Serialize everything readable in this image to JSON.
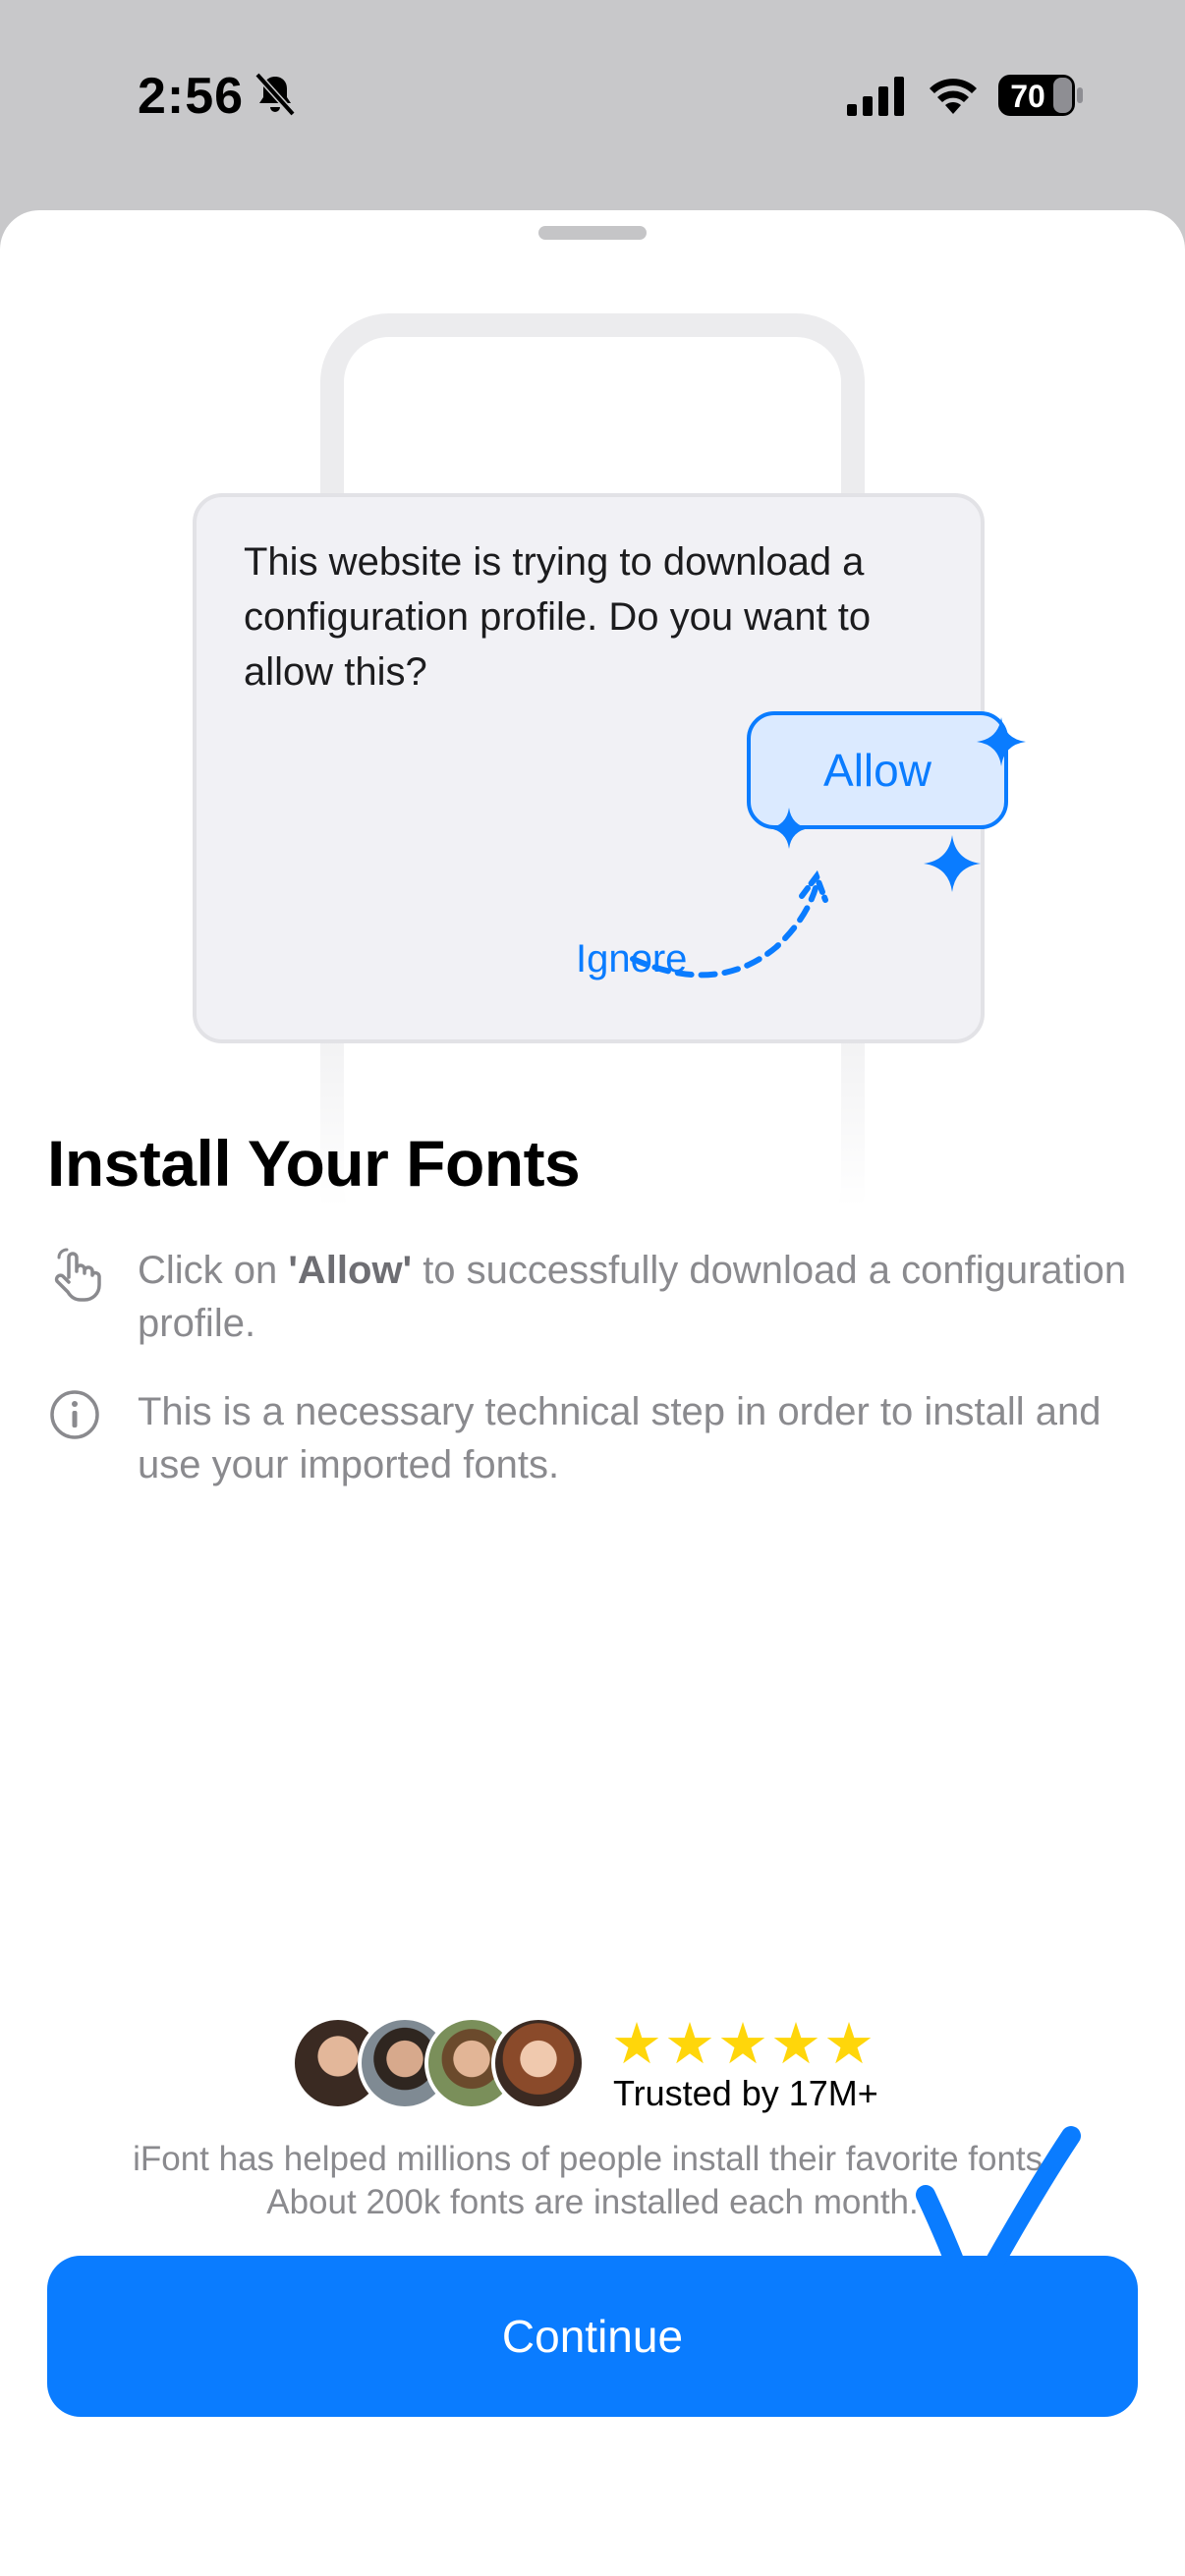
{
  "status_bar": {
    "time": "2:56",
    "battery": "70",
    "icons": [
      "bell-slash-icon",
      "signal-icon",
      "wifi-icon",
      "battery-icon"
    ]
  },
  "illustration": {
    "dialog_text": "This website is trying to download a configuration profile. Do you want to allow this?",
    "ignore_label": "Ignore",
    "allow_label": "Allow"
  },
  "content": {
    "title": "Install Your Fonts",
    "info_items": [
      {
        "icon": "hand-tap-icon",
        "text_before": "Click on ",
        "text_bold": "'Allow'",
        "text_after": " to successfully download a configuration profile."
      },
      {
        "icon": "info-circle-icon",
        "text": "This is a necessary technical step in order to install and use your imported fonts."
      }
    ]
  },
  "trust": {
    "stars": "★★★★★",
    "rating": 5,
    "trusted_label": "Trusted by 17M+",
    "line1": "iFont has helped millions of people install their favorite fonts.",
    "line2": "About 200k fonts are installed each month."
  },
  "cta": {
    "continue_label": "Continue"
  },
  "colors": {
    "accent": "#0a7cff",
    "star": "#ffd60a",
    "secondary_text": "#8a8a8e"
  }
}
